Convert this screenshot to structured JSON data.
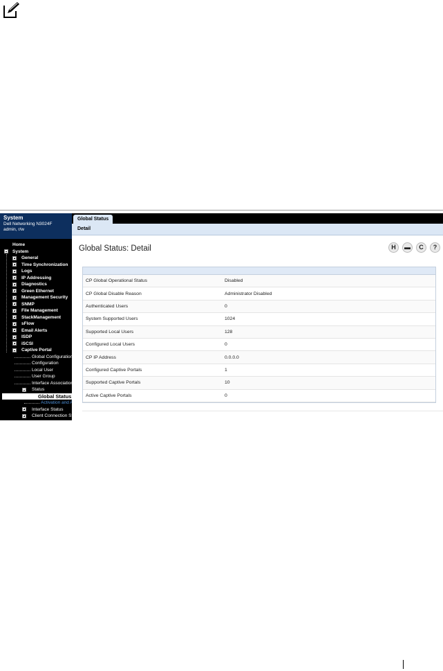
{
  "note_icon": "pencil-note-icon",
  "sidebar": {
    "title": "System",
    "device": "Dell Networking N3024F",
    "user": "admin, r/w",
    "tree": [
      {
        "label": "Home",
        "level": 0,
        "pm": "none"
      },
      {
        "label": "System",
        "level": 0,
        "pm": "minus"
      },
      {
        "label": "General",
        "level": 1,
        "pm": "plus"
      },
      {
        "label": "Time Synchronization",
        "level": 1,
        "pm": "plus"
      },
      {
        "label": "Logs",
        "level": 1,
        "pm": "plus"
      },
      {
        "label": "IP Addressing",
        "level": 1,
        "pm": "plus"
      },
      {
        "label": "Diagnostics",
        "level": 1,
        "pm": "plus"
      },
      {
        "label": "Green Ethernet",
        "level": 1,
        "pm": "plus"
      },
      {
        "label": "Management Security",
        "level": 1,
        "pm": "plus"
      },
      {
        "label": "SNMP",
        "level": 1,
        "pm": "plus"
      },
      {
        "label": "File Management",
        "level": 1,
        "pm": "plus"
      },
      {
        "label": "StackManagement",
        "level": 1,
        "pm": "plus"
      },
      {
        "label": "sFlow",
        "level": 1,
        "pm": "plus"
      },
      {
        "label": "Email Alerts",
        "level": 1,
        "pm": "plus"
      },
      {
        "label": "ISDP",
        "level": 1,
        "pm": "plus"
      },
      {
        "label": "iSCSI",
        "level": 1,
        "pm": "plus"
      },
      {
        "label": "Captive Portal",
        "level": 1,
        "pm": "minus"
      },
      {
        "label": "Global Configuration",
        "level": 2,
        "pm": "none"
      },
      {
        "label": "Configuration",
        "level": 2,
        "pm": "none"
      },
      {
        "label": "Local User",
        "level": 2,
        "pm": "none"
      },
      {
        "label": "User Group",
        "level": 2,
        "pm": "none"
      },
      {
        "label": "Interface Association",
        "level": 2,
        "pm": "none"
      },
      {
        "label": "Status",
        "level": 2,
        "pm": "minus"
      },
      {
        "label": "Global Status",
        "level": 3,
        "pm": "none",
        "state": "selected"
      },
      {
        "label": "Activation and Activity",
        "level": 3,
        "pm": "none",
        "state": "highlight"
      },
      {
        "label": "Interface Status",
        "level": 2,
        "pm": "plus"
      },
      {
        "label": "Client Connection Status",
        "level": 2,
        "pm": "plus"
      }
    ]
  },
  "main": {
    "tab": "Global Status",
    "subtab": "Detail",
    "title": "Global Status: Detail",
    "toolbar": [
      {
        "name": "save-icon",
        "glyph": "H"
      },
      {
        "name": "print-icon",
        "glyph": "▬"
      },
      {
        "name": "refresh-icon",
        "glyph": "C"
      },
      {
        "name": "help-icon",
        "glyph": "?"
      }
    ],
    "rows": [
      {
        "label": "CP Global Operational Status",
        "value": "Disabled"
      },
      {
        "label": "CP Global Disable Reason",
        "value": "Administrator Disabled"
      },
      {
        "label": "Authenticated Users",
        "value": "0"
      },
      {
        "label": "System Supported Users",
        "value": "1024"
      },
      {
        "label": "Supported Local Users",
        "value": "128"
      },
      {
        "label": "Configured Local Users",
        "value": "0"
      },
      {
        "label": "CP IP Address",
        "value": "0.0.0.0"
      },
      {
        "label": "Configured Captive Portals",
        "value": "1"
      },
      {
        "label": "Supported Captive Portals",
        "value": "10"
      },
      {
        "label": "Active Captive Portals",
        "value": "0"
      }
    ]
  }
}
